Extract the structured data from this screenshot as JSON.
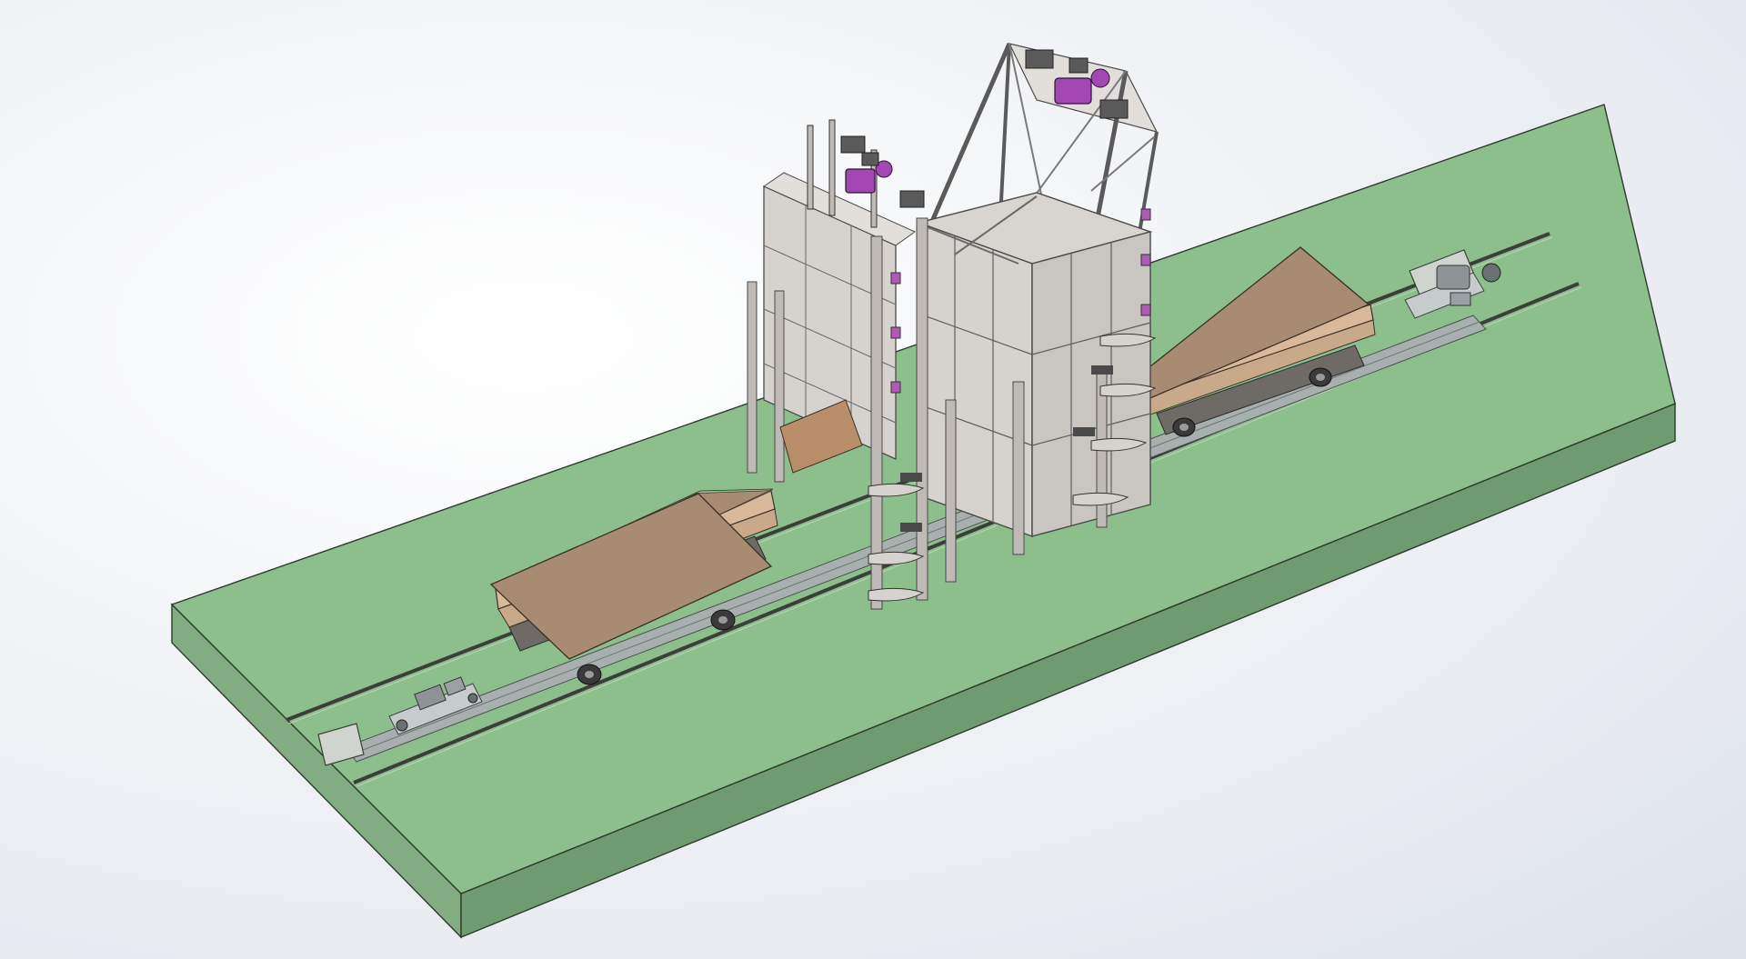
{
  "viewport": {
    "background_top": "#ffffff",
    "background_edge": "#dde2ea"
  },
  "model": {
    "base_platform": {
      "top_color": "#8dbf8d",
      "side_color": "#6f9b70",
      "end_color": "#82ad82"
    },
    "rail_track": {
      "color": "#3a3f3a",
      "rail_steel": "#9aa3a3"
    },
    "transfer_carts": {
      "count": 2,
      "deck_color": "#a88c72",
      "deck_edge_color": "#d9b99a",
      "wheel_color": "#3a3a3a"
    },
    "furnace_chambers": {
      "count": 2,
      "wall_color": "#d6d2ce",
      "frame_color": "#bfbab6",
      "outline_color": "#4a4a4a"
    },
    "door_lift_motors": {
      "count": 2,
      "color": "#a347b5"
    },
    "drive_units": {
      "count": 2,
      "color": "#8e9396"
    }
  }
}
